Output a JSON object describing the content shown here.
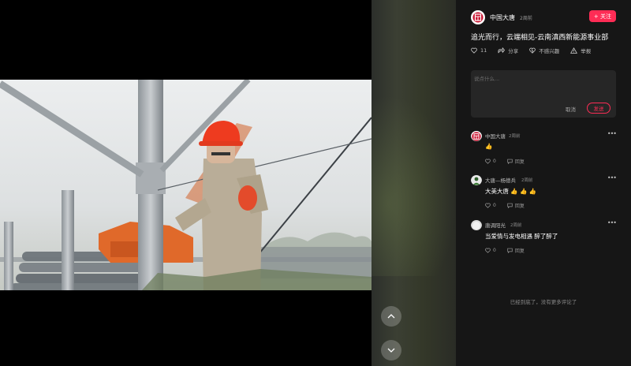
{
  "author": {
    "name": "中国大唐",
    "time": "2周前",
    "follow_label": "+ 关注"
  },
  "post": {
    "title": "追光而行，云端相见-云南滇西新能源事业部"
  },
  "actions": {
    "like_count": "11",
    "share_label": "分享",
    "dislike_label": "不感兴趣",
    "report_label": "举报"
  },
  "comment_box": {
    "placeholder": "说点什么...",
    "cancel_label": "取消",
    "send_label": "发送"
  },
  "comments": [
    {
      "name": "中国大唐",
      "time": "2周前",
      "text": "👍",
      "likes": "0",
      "reply_label": "回复"
    },
    {
      "name": "大唐—杨德兵",
      "time": "2周前",
      "text": "大美大唐 👍 👍 👍",
      "likes": "0",
      "reply_label": "回复"
    },
    {
      "name": "唐调阳光",
      "time": "2周前",
      "text": "当爱情与发电相遇 醉了醉了",
      "likes": "0",
      "reply_label": "回复"
    }
  ],
  "end_note": "已经到底了，没有更多评论了",
  "icons": {
    "prev": "chevron-up-icon",
    "next": "chevron-down-icon",
    "collapse": "chevron-right-icon",
    "like": "heart-icon",
    "share": "share-icon",
    "dislike": "heart-broken-icon",
    "report": "warning-icon",
    "more": "more-dots-icon",
    "reply": "message-icon"
  },
  "colors": {
    "accent": "#fe2c55",
    "panel_bg": "#161616",
    "input_bg": "#262626"
  }
}
